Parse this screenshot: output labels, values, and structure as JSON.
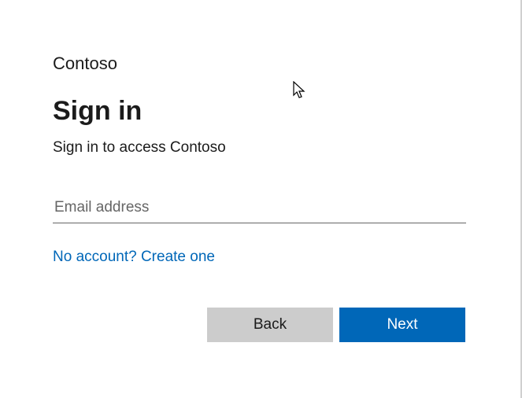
{
  "brand": "Contoso",
  "title": "Sign in",
  "subtitle": "Sign in to access Contoso",
  "email": {
    "placeholder": "Email address",
    "value": ""
  },
  "create_link": "No account? Create one",
  "buttons": {
    "back": "Back",
    "next": "Next"
  }
}
